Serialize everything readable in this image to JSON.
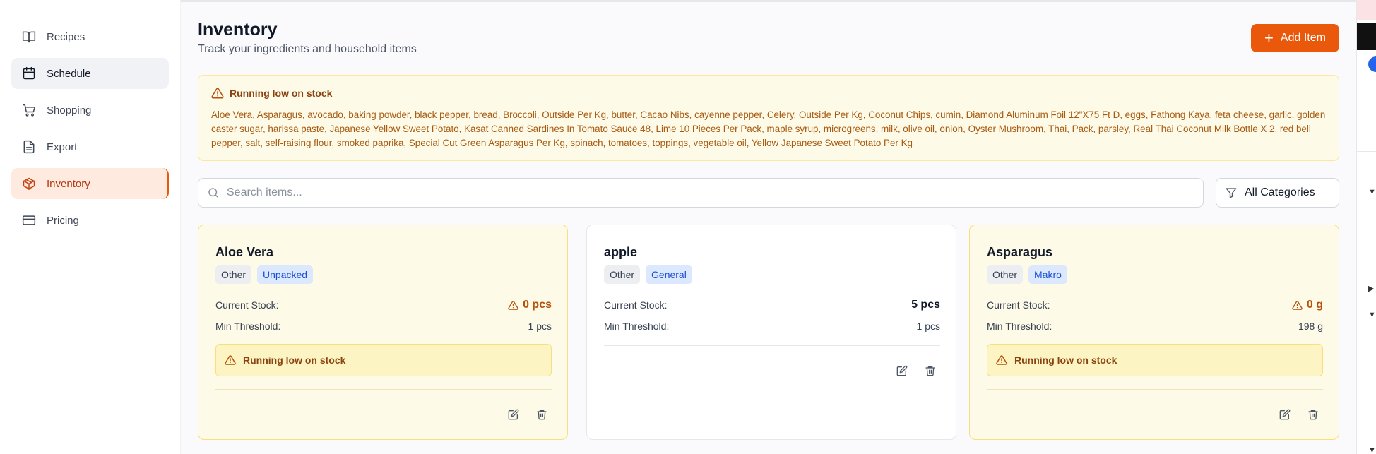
{
  "sidebar": {
    "items": [
      {
        "label": "Recipes",
        "icon": "book-open-icon"
      },
      {
        "label": "Schedule",
        "icon": "calendar-icon"
      },
      {
        "label": "Shopping",
        "icon": "shopping-cart-icon"
      },
      {
        "label": "Export",
        "icon": "file-text-icon"
      },
      {
        "label": "Inventory",
        "icon": "package-icon"
      },
      {
        "label": "Pricing",
        "icon": "credit-card-icon"
      }
    ],
    "active": "Inventory"
  },
  "header": {
    "title": "Inventory",
    "subtitle": "Track your ingredients and household items",
    "add_button": "Add Item"
  },
  "low_stock_alert": {
    "title": "Running low on stock",
    "items_text": "Aloe Vera, Asparagus, avocado, baking powder, black pepper, bread, Broccoli, Outside Per Kg, butter, Cacao Nibs, cayenne pepper, Celery, Outside Per Kg, Coconut Chips, cumin, Diamond Aluminum Foil 12\"X75 Ft D, eggs, Fathong Kaya, feta cheese, garlic, golden caster sugar, harissa paste, Japanese Yellow Sweet Potato, Kasat Canned Sardines In Tomato Sauce 48, Lime 10 Pieces Per Pack, maple syrup, microgreens, milk, olive oil, onion, Oyster Mushroom, Thai, Pack, parsley, Real Thai Coconut Milk Bottle X 2, red bell pepper, salt, self-raising flour, smoked paprika, Special Cut Green Asparagus Per Kg, spinach, tomatoes, toppings, vegetable oil, Yellow Japanese Sweet Potato Per Kg"
  },
  "search": {
    "placeholder": "Search items...",
    "value": ""
  },
  "category_filter": {
    "selected": "All Categories"
  },
  "labels": {
    "current_stock": "Current Stock:",
    "min_threshold": "Min Threshold:",
    "low_stock_note": "Running low on stock"
  },
  "items": [
    {
      "name": "Aloe Vera",
      "category": "Other",
      "store": "Unpacked",
      "current_stock": "0 pcs",
      "min_threshold": "1 pcs",
      "low": true
    },
    {
      "name": "apple",
      "category": "Other",
      "store": "General",
      "current_stock": "5 pcs",
      "min_threshold": "1 pcs",
      "low": false
    },
    {
      "name": "Asparagus",
      "category": "Other",
      "store": "Makro",
      "current_stock": "0 g",
      "min_threshold": "198 g",
      "low": true
    }
  ],
  "colors": {
    "accent": "#ea580c",
    "warning_bg": "#fefae8",
    "warning_text": "#a85a10",
    "store_tag": "#dbe8fe"
  }
}
